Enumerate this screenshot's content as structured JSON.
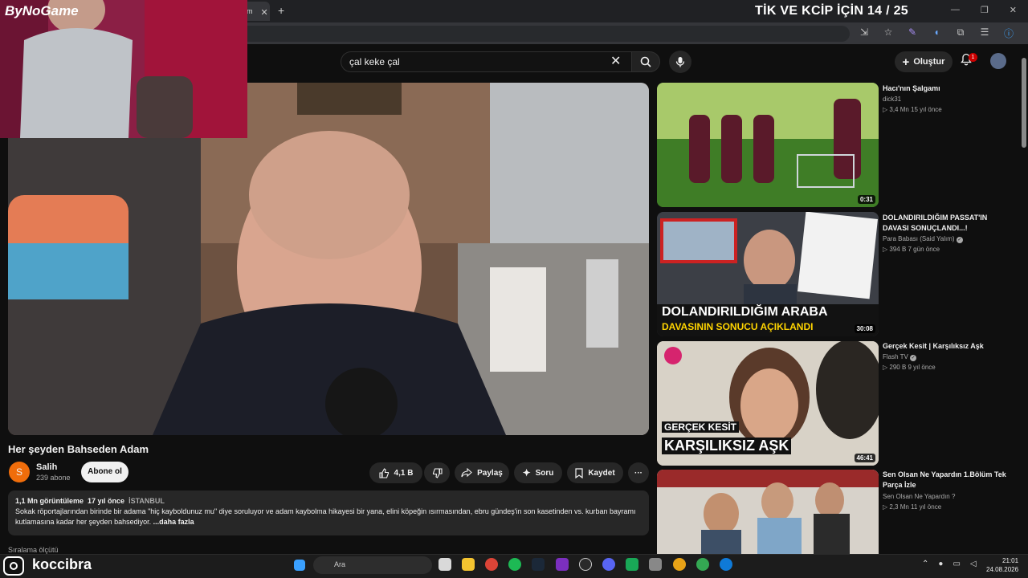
{
  "browser": {
    "tab_title": "am",
    "tab_close": "✕",
    "new_tab": "+",
    "window_controls": [
      "—",
      "❐",
      "✕"
    ]
  },
  "overlay": {
    "title": "TİK VE KCİP İÇİN 14 / 25",
    "brand": "ByNoGame",
    "streamer_name": "koccibra"
  },
  "header": {
    "search_value": "çal keke çal",
    "create_label": "Oluştur",
    "notification_count": "1"
  },
  "video": {
    "title": "Her şeyden Bahseden Adam",
    "channel": {
      "initial": "S",
      "name": "Salih",
      "subscribers": "239 abone"
    },
    "subscribe_label": "Abone ol",
    "actions": {
      "likes": "4,1 B",
      "share": "Paylaş",
      "ask": "Soru",
      "save": "Kaydet",
      "more": "···"
    },
    "description": {
      "views": "1,1 Mn görüntüleme",
      "age": "17 yıl önce",
      "tag": "İSTANBUL",
      "text": "Sokak röportajlarından birinde bir adama \"hiç kayboldunuz mu\" diye soruluyor ve adam kaybolma hikayesi bir yana, elini köpeğin ısırmasından, ebru gündeş'in son kasetinden vs. kurban bayramı kutlamasına kadar her şeyden bahsediyor.",
      "more": "...daha fazla"
    },
    "below_label": "Sıralama ölçütü"
  },
  "recommendations": [
    {
      "title": "Hacı'nın Şalgamı",
      "channel": "dick31",
      "stats": "▷ 3,4 Mn  15 yıl önce",
      "duration": "0:31",
      "thumb_text_1": "",
      "thumb_text_2": ""
    },
    {
      "title": "DOLANDIRILDIĞIM PASSAT'IN DAVASI SONUÇLANDI...!",
      "channel": "Para Babası (Said Yalım)",
      "stats": "▷ 394 B  7 gün önce",
      "duration": "30:08",
      "thumb_text_1": "DOLANDIRILDIĞIM ARABA",
      "thumb_text_2": "DAVASININ SONUCU AÇIKLANDI"
    },
    {
      "title": "Gerçek Kesit | Karşılıksız Aşk",
      "channel": "Flash TV",
      "stats": "▷ 290 B  9 yıl önce",
      "duration": "46:41",
      "thumb_text_1": "GERÇEK KESİT",
      "thumb_text_2": "KARŞILIKSIZ AŞK"
    },
    {
      "title": "Sen Olsan Ne Yapardın  1.Bölüm Tek Parça İzle",
      "channel": "Sen Olsan Ne Yapardın ?",
      "stats": "▷ 2,3 Mn  11 yıl önce",
      "duration": "",
      "thumb_text_1": "",
      "thumb_text_2": ""
    }
  ],
  "taskbar": {
    "search_placeholder": "Ara",
    "time": "21:01",
    "date": "24.08.2026"
  },
  "colors": {
    "bg": "#0f0f0f",
    "accent_red": "#cc0000",
    "chip": "#272727"
  }
}
